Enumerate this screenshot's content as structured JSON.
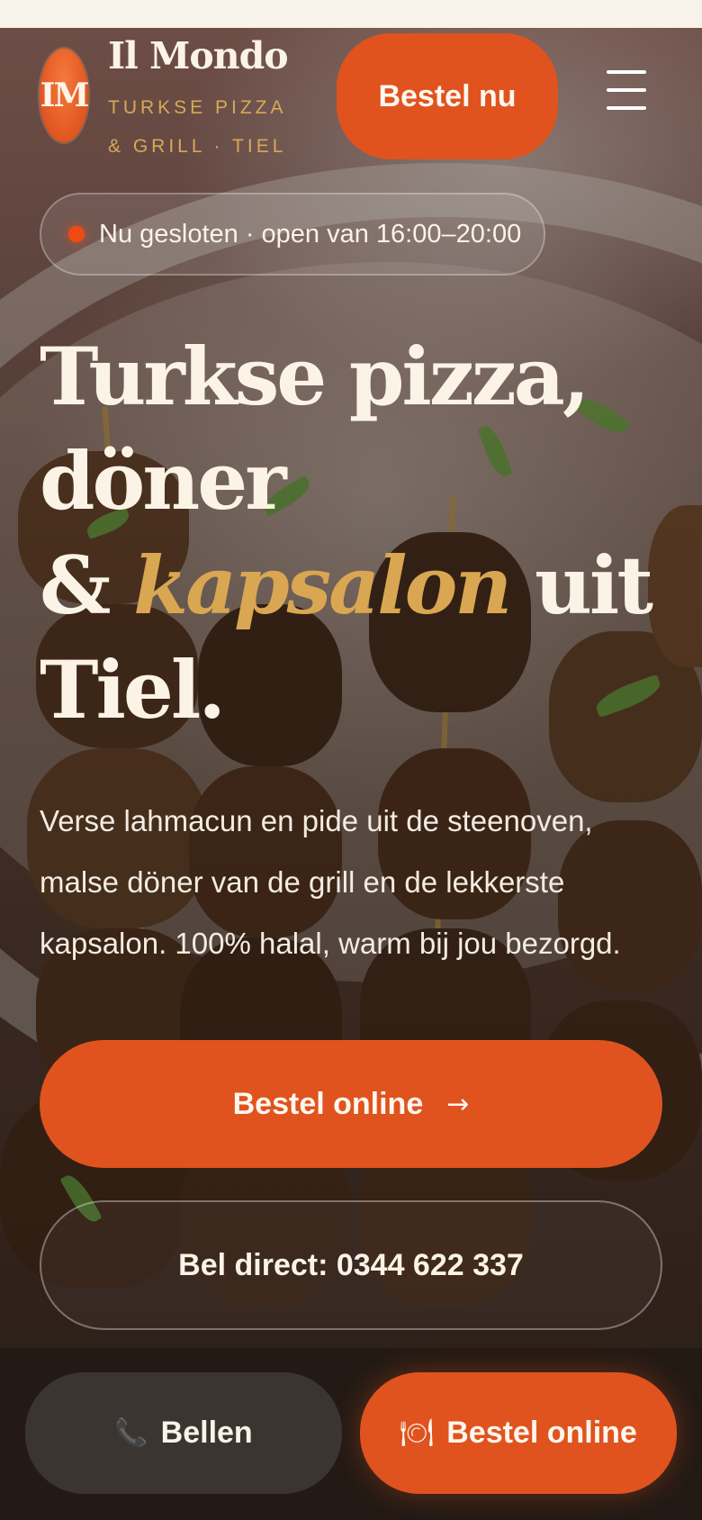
{
  "brand": {
    "monogram": "IM",
    "name": "Il Mondo",
    "subtitle": "TURKSE PIZZA & GRILL · TIEL"
  },
  "header": {
    "order_label": "Bestel nu",
    "menu_icon": "hamburger-menu-icon"
  },
  "status": {
    "text": "Nu gesloten · open van 16:00–20:00",
    "dot_color": "#f04a14"
  },
  "hero": {
    "headline_line1": "Turkse pizza,",
    "headline_line2": "döner",
    "headline_amp": "&",
    "headline_accent": "kapsalon",
    "headline_after_accent": "uit",
    "headline_line4": "Tiel.",
    "intro": "Verse lahmacun en pide uit de steenoven, malse döner van de grill en de lekkerste kapsalon. 100% halal, warm bij jou bezorgd."
  },
  "cta": {
    "primary_label": "Bestel online",
    "primary_icon": "arrow-right-icon",
    "secondary_label": "Bel direct: 0344 622 337"
  },
  "bottom_bar": {
    "call_label": "Bellen",
    "call_icon": "phone-icon",
    "order_label": "Bestel online",
    "order_icon": "plate-cutlery-icon"
  },
  "colors": {
    "accent": "#e0531e",
    "gold": "#d9a652",
    "cream": "#fbf3e6",
    "dark_bar": "#231a15"
  }
}
